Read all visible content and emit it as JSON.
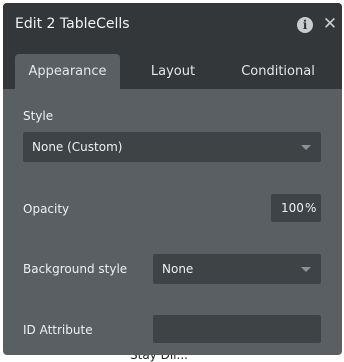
{
  "window": {
    "title": "Edit 2 TableCells",
    "info_icon": "info-icon",
    "close_icon": "close-icon"
  },
  "tabs": [
    {
      "label": "Appearance",
      "active": true
    },
    {
      "label": "Layout",
      "active": false
    },
    {
      "label": "Conditional",
      "active": false
    }
  ],
  "style": {
    "label": "Style",
    "value": "None (Custom)"
  },
  "opacity": {
    "label": "Opacity",
    "value": "100",
    "unit": "%"
  },
  "background_style": {
    "label": "Background style",
    "value": "None"
  },
  "id_attribute": {
    "label": "ID Attribute",
    "value": ""
  },
  "backdrop": {
    "partial_text": "Stay Dil..."
  }
}
